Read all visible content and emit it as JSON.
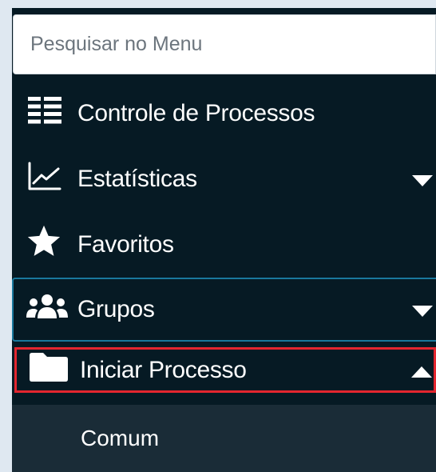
{
  "search": {
    "placeholder": "Pesquisar no Menu"
  },
  "menu": {
    "items": [
      {
        "label": "Controle de Processos",
        "icon": "list-icon"
      },
      {
        "label": "Estatísticas",
        "icon": "line-chart-icon",
        "expandable": true,
        "expanded": false
      },
      {
        "label": "Favoritos",
        "icon": "star-icon"
      },
      {
        "label": "Grupos",
        "icon": "users-icon",
        "expandable": true,
        "expanded": false
      },
      {
        "label": "Iniciar Processo",
        "icon": "folder-icon",
        "expandable": true,
        "expanded": true
      }
    ],
    "submenu": [
      {
        "label": "Comum"
      }
    ]
  },
  "colors": {
    "sidebar_bg": "#061a24",
    "submenu_bg": "#1a2c37",
    "highlight_border": "#e3262f",
    "focus_border": "#19789d",
    "page_bg": "#dfe8f1"
  }
}
